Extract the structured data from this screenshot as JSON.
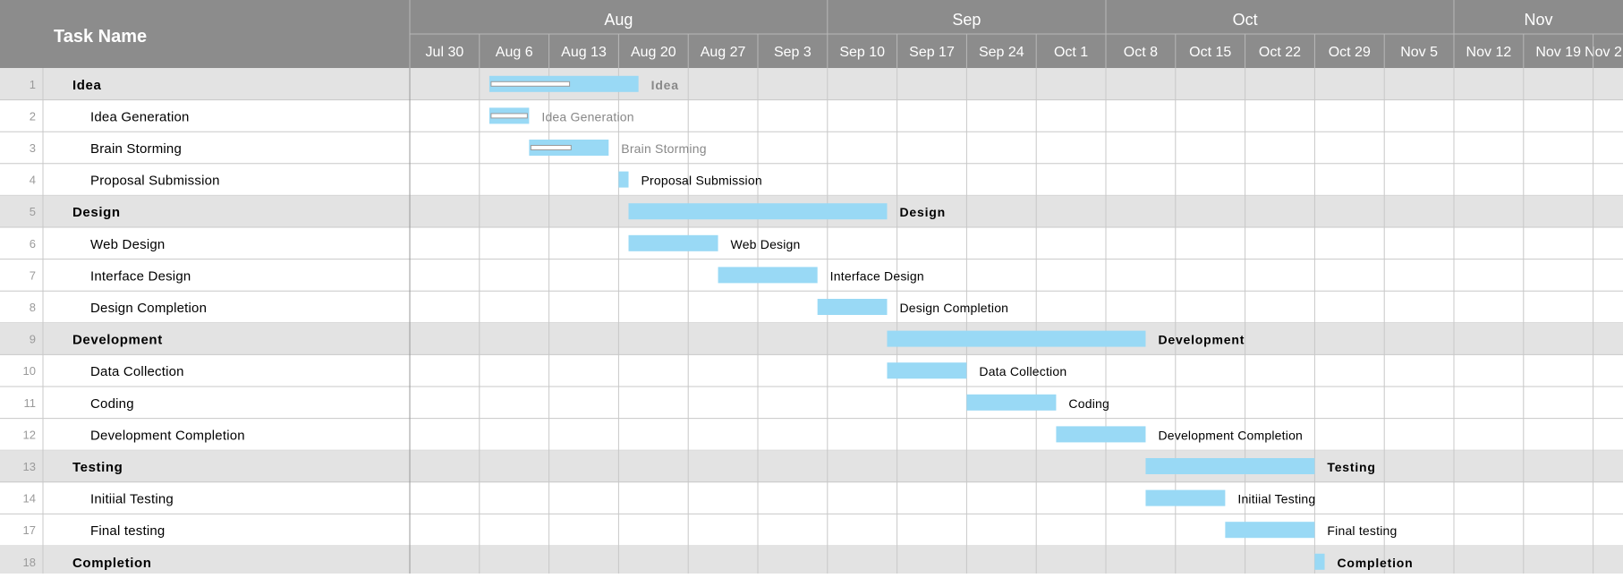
{
  "header": {
    "task_name_label": "Task Name",
    "months": [
      "Aug",
      "Sep",
      "Oct",
      "Nov"
    ],
    "weeks": [
      "Jul 30",
      "Aug 6",
      "Aug 13",
      "Aug 20",
      "Aug 27",
      "Sep 3",
      "Sep 10",
      "Sep 17",
      "Sep 24",
      "Oct 1",
      "Oct 8",
      "Oct 15",
      "Oct 22",
      "Oct 29",
      "Nov 5",
      "Nov 12",
      "Nov 19",
      "Nov 2"
    ]
  },
  "colors": {
    "header_bg": "#8c8c8c",
    "header_text": "#ffffff",
    "summary_row_bg": "#e3e3e3",
    "bar": "#99d9f5",
    "progress": "#ffffff",
    "grid": "#c8c8c8",
    "row_number": "#9a9a9a",
    "label_text": "#000000",
    "label_text_muted": "#888888"
  },
  "chart_data": {
    "type": "gantt",
    "x_axis": "date",
    "xlim": [
      "2012-07-30",
      "2012-12-01"
    ],
    "tasks": [
      {
        "row": "1",
        "name": "Idea",
        "summary": true,
        "start": "2012-08-07",
        "end": "2012-08-22",
        "progress": 0.55,
        "label": "Idea",
        "label_style": "muted"
      },
      {
        "row": "2",
        "name": "Idea Generation",
        "summary": false,
        "start": "2012-08-07",
        "end": "2012-08-11",
        "progress": 1.0,
        "label": "Idea Generation",
        "label_style": "muted"
      },
      {
        "row": "3",
        "name": "Brain Storming",
        "summary": false,
        "start": "2012-08-11",
        "end": "2012-08-19",
        "progress": 0.55,
        "label": "Brain Storming",
        "label_style": "muted"
      },
      {
        "row": "4",
        "name": "Proposal Submission",
        "summary": false,
        "start": "2012-08-20",
        "end": "2012-08-21",
        "progress": 0,
        "label": "Proposal Submission",
        "label_style": "normal"
      },
      {
        "row": "5",
        "name": "Design",
        "summary": true,
        "start": "2012-08-21",
        "end": "2012-09-16",
        "progress": 0,
        "label": "Design",
        "label_style": "normal"
      },
      {
        "row": "6",
        "name": "Web Design",
        "summary": false,
        "start": "2012-08-21",
        "end": "2012-08-30",
        "progress": 0,
        "label": "Web Design",
        "label_style": "normal"
      },
      {
        "row": "7",
        "name": "Interface Design",
        "summary": false,
        "start": "2012-08-30",
        "end": "2012-09-09",
        "progress": 0,
        "label": "Interface Design",
        "label_style": "normal"
      },
      {
        "row": "8",
        "name": "Design Completion",
        "summary": false,
        "start": "2012-09-09",
        "end": "2012-09-16",
        "progress": 0,
        "label": "Design Completion",
        "label_style": "normal"
      },
      {
        "row": "9",
        "name": "Development",
        "summary": true,
        "start": "2012-09-16",
        "end": "2012-10-12",
        "progress": 0,
        "label": "Development",
        "label_style": "normal"
      },
      {
        "row": "10",
        "name": "Data Collection",
        "summary": false,
        "start": "2012-09-16",
        "end": "2012-09-24",
        "progress": 0,
        "label": "Data Collection",
        "label_style": "normal"
      },
      {
        "row": "11",
        "name": "Coding",
        "summary": false,
        "start": "2012-09-24",
        "end": "2012-10-03",
        "progress": 0,
        "label": "Coding",
        "label_style": "normal"
      },
      {
        "row": "12",
        "name": "Development Completion",
        "summary": false,
        "start": "2012-10-03",
        "end": "2012-10-12",
        "progress": 0,
        "label": "Development Completion",
        "label_style": "normal"
      },
      {
        "row": "13",
        "name": "Testing",
        "summary": true,
        "start": "2012-10-12",
        "end": "2012-10-29",
        "progress": 0,
        "label": "Testing",
        "label_style": "normal"
      },
      {
        "row": "14",
        "name": "Initiial Testing",
        "summary": false,
        "start": "2012-10-12",
        "end": "2012-10-20",
        "progress": 0,
        "label": "Initiial Testing",
        "label_style": "normal"
      },
      {
        "row": "17",
        "name": "Final testing",
        "summary": false,
        "start": "2012-10-20",
        "end": "2012-10-29",
        "progress": 0,
        "label": "Final testing",
        "label_style": "normal"
      },
      {
        "row": "18",
        "name": "Completion",
        "summary": true,
        "start": "2012-10-29",
        "end": "2012-10-30",
        "progress": 0,
        "label": "Completion",
        "label_style": "normal"
      }
    ]
  }
}
